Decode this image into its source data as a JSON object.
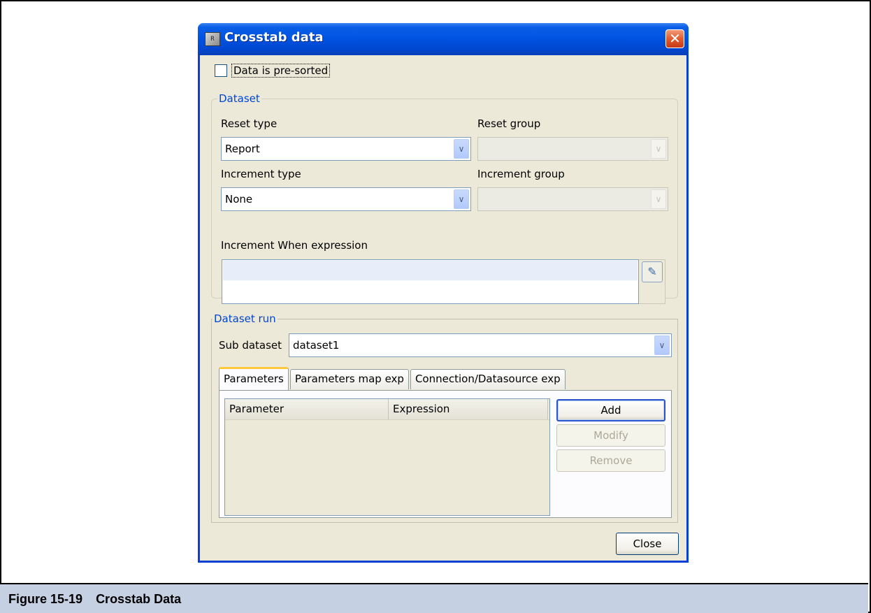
{
  "dialog": {
    "title": "Crosstab data",
    "icon": "report-app-icon",
    "close_glyph": "✕"
  },
  "presorted": {
    "label": "Data is pre-sorted",
    "checked": false
  },
  "dataset": {
    "legend": "Dataset",
    "reset_type": {
      "label": "Reset type",
      "value": "Report"
    },
    "reset_group": {
      "label": "Reset group",
      "value": ""
    },
    "increment_type": {
      "label": "Increment type",
      "value": "None"
    },
    "increment_group": {
      "label": "Increment group",
      "value": ""
    },
    "increment_when": {
      "label": "Increment When expression",
      "value": ""
    }
  },
  "run": {
    "legend": "Dataset run",
    "sub_dataset": {
      "label": "Sub dataset",
      "value": "dataset1"
    },
    "tabs": [
      "Parameters",
      "Parameters map exp",
      "Connection/Datasource exp"
    ],
    "columns": [
      "Parameter",
      "Expression"
    ],
    "buttons": {
      "add": "Add",
      "modify": "Modify",
      "remove": "Remove"
    }
  },
  "close_label": "Close",
  "caption": {
    "number": "Figure 15-19",
    "text": "Crosstab Data"
  },
  "colors": {
    "title_bar": "#0054e3",
    "legend_text": "#0046d5",
    "dialog_bg": "#ece9d8",
    "caption_bg": "#c6d0e3"
  }
}
